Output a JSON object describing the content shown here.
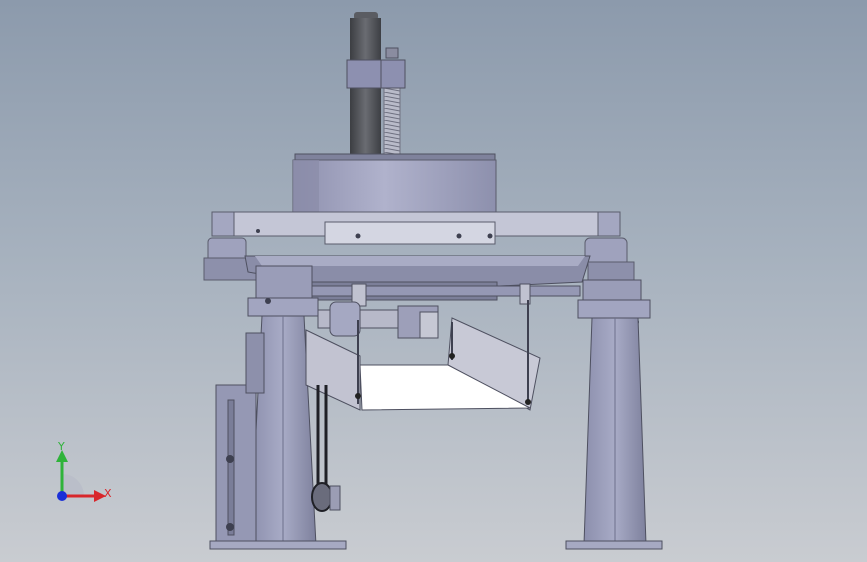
{
  "viewport": {
    "background_top": "#8c9aac",
    "background_bottom": "#c9ccd1"
  },
  "model": {
    "metal_color": "#9c9fbe",
    "metal_dark": "#5d6070",
    "motor_color": "#4b4d52",
    "chute_color": "#c3c4d2"
  },
  "triad": {
    "x_label": "X",
    "y_label": "Y",
    "x_color": "#d8262b",
    "y_color": "#2fb33a",
    "z_color": "#1a2fd8"
  }
}
